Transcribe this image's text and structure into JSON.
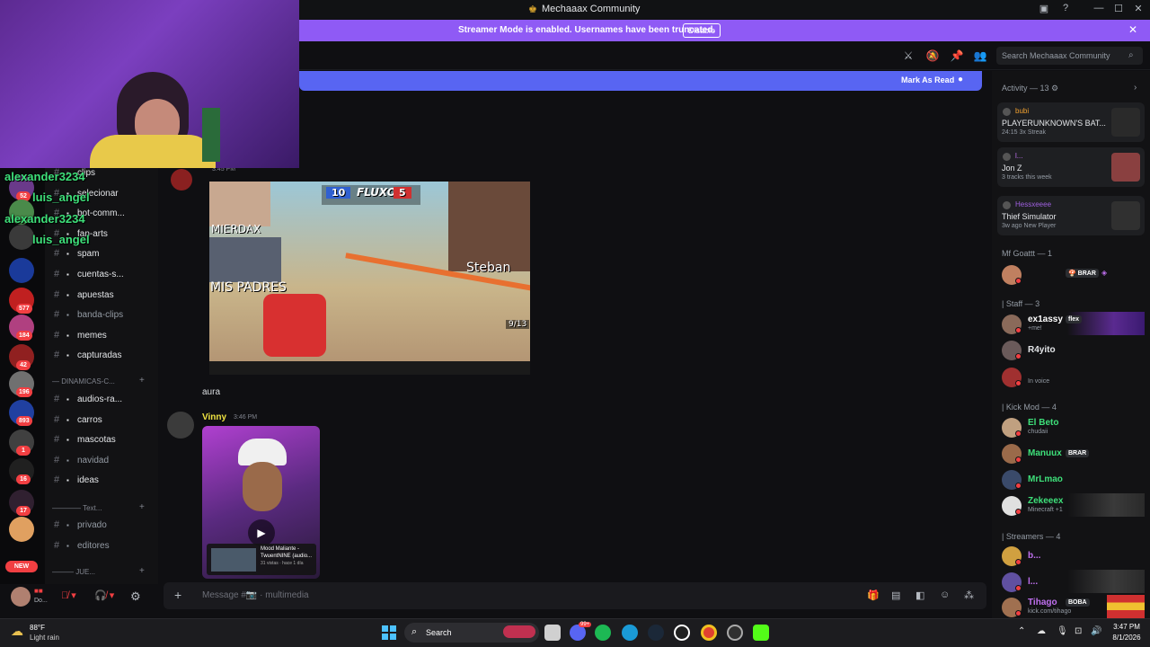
{
  "window": {
    "title": "Mechaaax Community",
    "title_icon": "server-crown-icon"
  },
  "banner": {
    "text": "Streamer Mode is enabled. Usernames have been truncated.",
    "disable_label": "Disable"
  },
  "header": {
    "search_placeholder": "Search Mechaaax Community",
    "mark_as_read": "Mark As Read"
  },
  "overlay_chat": [
    {
      "name": "alexander3234",
      "color": "#3ee07a"
    },
    {
      "name": "luis_angel",
      "color": "#3ee07a"
    },
    {
      "name": "alexander3234",
      "color": "#3ee07a"
    },
    {
      "name": "luis_angel",
      "color": "#3ee07a"
    }
  ],
  "servers": [
    {
      "badge": "52",
      "color": "#6a3a8a"
    },
    {
      "badge": "",
      "color": "#4a8a4a"
    },
    {
      "badge": "",
      "color": "#3a3a3a"
    },
    {
      "badge": "",
      "color": "#1a3a9a"
    },
    {
      "badge": "577",
      "color": "#c02020"
    },
    {
      "badge": "184",
      "color": "#b04080"
    },
    {
      "badge": "42",
      "color": "#902020"
    },
    {
      "badge": "196",
      "color": "#707070"
    },
    {
      "badge": "893",
      "color": "#2040a0"
    },
    {
      "badge": "1",
      "color": "#404040"
    },
    {
      "badge": "16",
      "color": "#202020"
    },
    {
      "badge": "17",
      "color": "#302030"
    },
    {
      "badge": "",
      "color": "#e0a060"
    }
  ],
  "new_label": "NEW",
  "channels": [
    {
      "name": "clips",
      "bright": true
    },
    {
      "name": "selecionar",
      "bright": true
    },
    {
      "name": "bot-comm...",
      "bright": true
    },
    {
      "name": "fan-arts",
      "bright": true
    },
    {
      "name": "spam",
      "bright": true
    },
    {
      "name": "cuentas-s...",
      "bright": true
    },
    {
      "name": "apuestas",
      "bright": true
    },
    {
      "name": "banda-clips",
      "bright": false
    },
    {
      "name": "memes",
      "bright": true
    },
    {
      "name": "capturadas",
      "bright": true
    }
  ],
  "category_dinamicas": "DINAMICAS-C...",
  "channels2": [
    {
      "name": "audios-ra...",
      "bright": true
    },
    {
      "name": "carros",
      "bright": true
    },
    {
      "name": "mascotas",
      "bright": true
    },
    {
      "name": "navidad",
      "bright": false
    },
    {
      "name": "ideas",
      "bright": true
    }
  ],
  "category_text": "Text...",
  "channels3": [
    {
      "name": "privado",
      "bright": false
    },
    {
      "name": "editores",
      "bright": false
    }
  ],
  "category_jue": "JUE...",
  "user_panel": {
    "name": "",
    "status": "Do..."
  },
  "chat": {
    "top_time": "3:45 PM",
    "game_labels": {
      "blue_score": "10",
      "brand": "FLUXO",
      "red_score": "5",
      "left_name": "MIERDAX",
      "bottom_caption": "MIS PADRES",
      "right_name": "Steban",
      "ammo": "9/13"
    },
    "message_aura": "aura",
    "vinny": {
      "name": "Vinny",
      "time": "3:46 PM",
      "video_title": "Mood Maliante - TwuentNINE (audio...",
      "video_meta": "31 vistas · hace 1 día"
    }
  },
  "composer": {
    "placeholder": "Message #📷 · multimedia"
  },
  "activity": {
    "header": "Activity — 13",
    "cards": [
      {
        "user": "bubi",
        "user_color": "#f0a030",
        "game": "PLAYERUNKNOWN'S BAT...",
        "meta1": "24:15",
        "meta2": "3x Streak",
        "thumb": "#2a2a2a"
      },
      {
        "user": "l...",
        "user_color": "#c070f0",
        "game": "Jon Z",
        "meta1": "3 tracks this week",
        "meta2": "",
        "thumb": "#8a4040"
      },
      {
        "user": "Hessxeeee",
        "user_color": "#a060e0",
        "game": "Thief Simulator",
        "meta1": "3w ago",
        "meta2": "New Player",
        "thumb": "#303030"
      }
    ]
  },
  "groups": {
    "goattt": "Mf Goattt — 1",
    "staff": "| Staff — 3",
    "kickmod": "| Kick Mod — 4",
    "streamers": "| Streamers — 4"
  },
  "members": {
    "goattt_tag": "BRAR",
    "staff": [
      {
        "name": "ex1assy",
        "color": "#ffffff",
        "tag": "flex",
        "sub": "+me!"
      },
      {
        "name": "R4yito",
        "color": "#e3e5e8",
        "sub": ""
      },
      {
        "name": "",
        "color": "#e3e5e8",
        "sub": "In voice"
      }
    ],
    "kickmod": [
      {
        "name": "El Beto",
        "color": "#3ee07a",
        "sub": "chudaii"
      },
      {
        "name": "Manuux",
        "color": "#3ee07a",
        "tag": "BRAR",
        "sub": ""
      },
      {
        "name": "MrLmao",
        "color": "#3ee07a",
        "sub": ""
      },
      {
        "name": "Zekeeex",
        "color": "#3ee07a",
        "sub": "Minecraft +1"
      }
    ],
    "streamers": [
      {
        "name": "b...",
        "color": "#c070f0",
        "sub": ""
      },
      {
        "name": "l...",
        "color": "#c070f0",
        "sub": ""
      },
      {
        "name": "Tihago",
        "color": "#c070f0",
        "tag": "BOBA",
        "sub": "kick.com/tihago"
      }
    ]
  },
  "taskbar": {
    "weather_temp": "88°F",
    "weather_desc": "Light rain",
    "search_label": "Search",
    "time": "3:47 PM",
    "date": "8/1/2026",
    "badge": "99+"
  }
}
